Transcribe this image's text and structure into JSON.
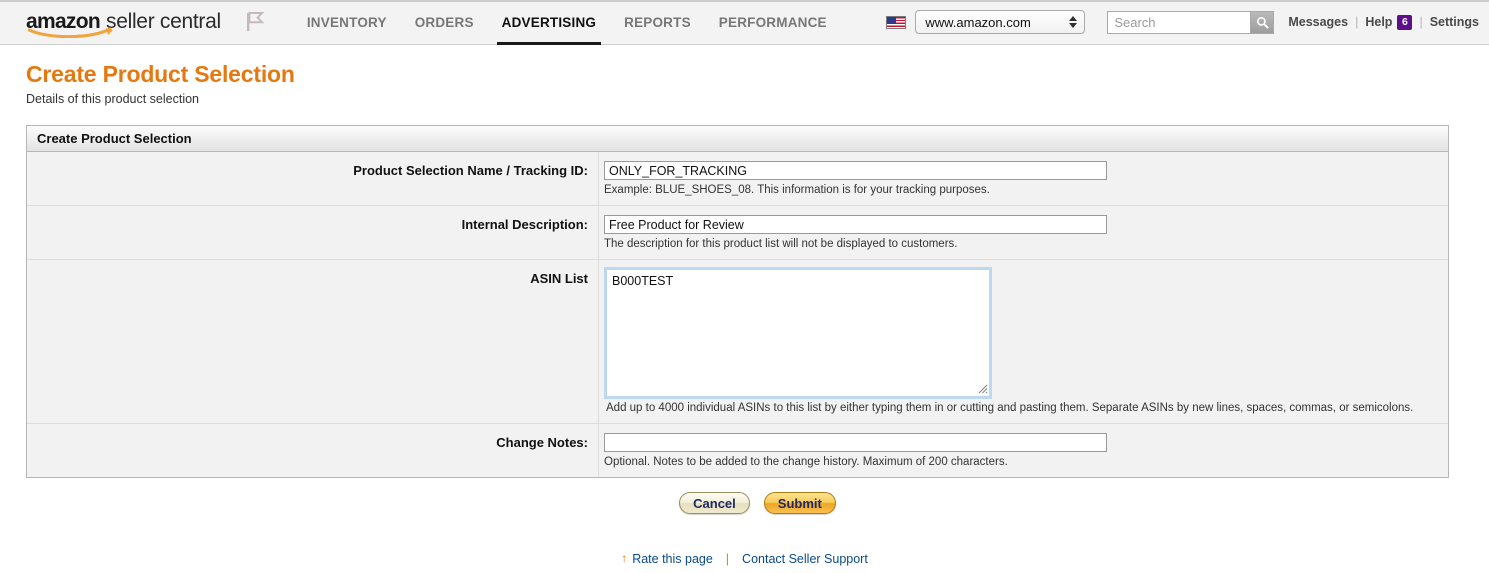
{
  "header": {
    "logo": {
      "brand": "amazon",
      "product": "seller central"
    },
    "flag_icon": "flag-outline-icon",
    "nav": [
      {
        "label": "INVENTORY",
        "active": false
      },
      {
        "label": "ORDERS",
        "active": false
      },
      {
        "label": "ADVERTISING",
        "active": true
      },
      {
        "label": "REPORTS",
        "active": false
      },
      {
        "label": "PERFORMANCE",
        "active": false
      }
    ],
    "marketplace": {
      "flag_icon": "us-flag-icon",
      "selected": "www.amazon.com",
      "options": [
        "www.amazon.com"
      ]
    },
    "search": {
      "value": "",
      "placeholder": "Search",
      "button_icon": "search-icon"
    },
    "links": {
      "messages": "Messages",
      "help": "Help",
      "help_badge": "6",
      "settings": "Settings",
      "separator": "|"
    }
  },
  "page": {
    "title": "Create Product Selection",
    "subtitle": "Details of this product selection"
  },
  "panel": {
    "heading": "Create Product Selection",
    "fields": [
      {
        "label": "Product Selection Name / Tracking ID:",
        "value": "ONLY_FOR_TRACKING",
        "placeholder": "",
        "hint": "Example: BLUE_SHOES_08. This information is for your tracking purposes."
      },
      {
        "label": "Internal Description:",
        "value": "Free Product for Review",
        "placeholder": "",
        "hint": "The description for this product list will not be displayed to customers."
      },
      {
        "label": "ASIN List",
        "value": "B000TEST",
        "placeholder": "",
        "hint": "Add up to 4000 individual ASINs to this list by either typing them in or cutting and pasting them. Separate ASINs by new lines, spaces, commas, or semicolons."
      },
      {
        "label": "Change Notes:",
        "value": "",
        "placeholder": "",
        "hint": "Optional. Notes to be added to the change history. Maximum of 200 characters."
      }
    ]
  },
  "actions": {
    "cancel": "Cancel",
    "submit": "Submit"
  },
  "footer": {
    "rate_icon": "up-arrow-icon",
    "rate_label": "Rate this page",
    "separator": "|",
    "support_label": "Contact Seller Support"
  },
  "colors": {
    "accent_orange": "#e47911",
    "link_blue": "#0a4a8a",
    "badge_purple": "#5b0f8b",
    "submit_yellow": "#f8cd5c",
    "row_bg": "#f2f2f2"
  }
}
